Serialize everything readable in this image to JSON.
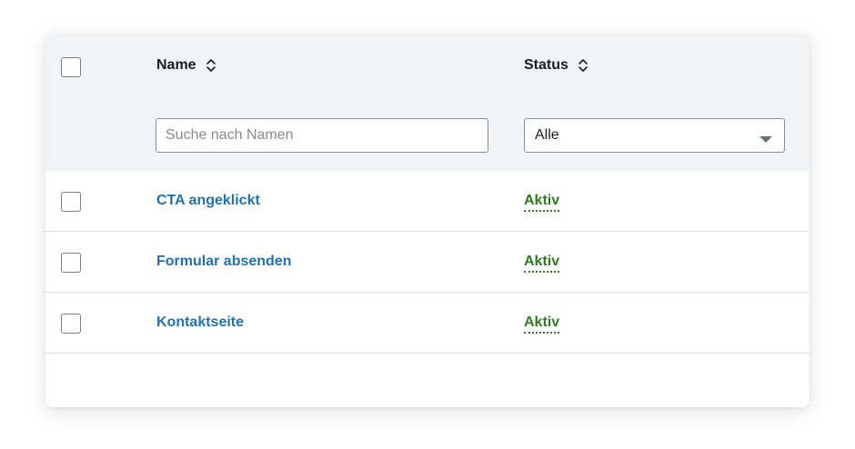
{
  "table": {
    "columns": {
      "name_label": "Name",
      "status_label": "Status"
    },
    "filters": {
      "search_placeholder": "Suche nach Namen",
      "search_value": "",
      "status_selected": "Alle"
    },
    "rows": [
      {
        "name": "CTA angeklickt",
        "status": "Aktiv"
      },
      {
        "name": "Formular absenden",
        "status": "Aktiv"
      },
      {
        "name": "Kontaktseite",
        "status": "Aktiv"
      }
    ]
  },
  "colors": {
    "header_bg": "#f2f3f5",
    "link": "#2271b1",
    "status_active": "#2e7d1f"
  },
  "icons": {
    "sort": "sort-icon",
    "dropdown": "chevron-down-icon"
  }
}
